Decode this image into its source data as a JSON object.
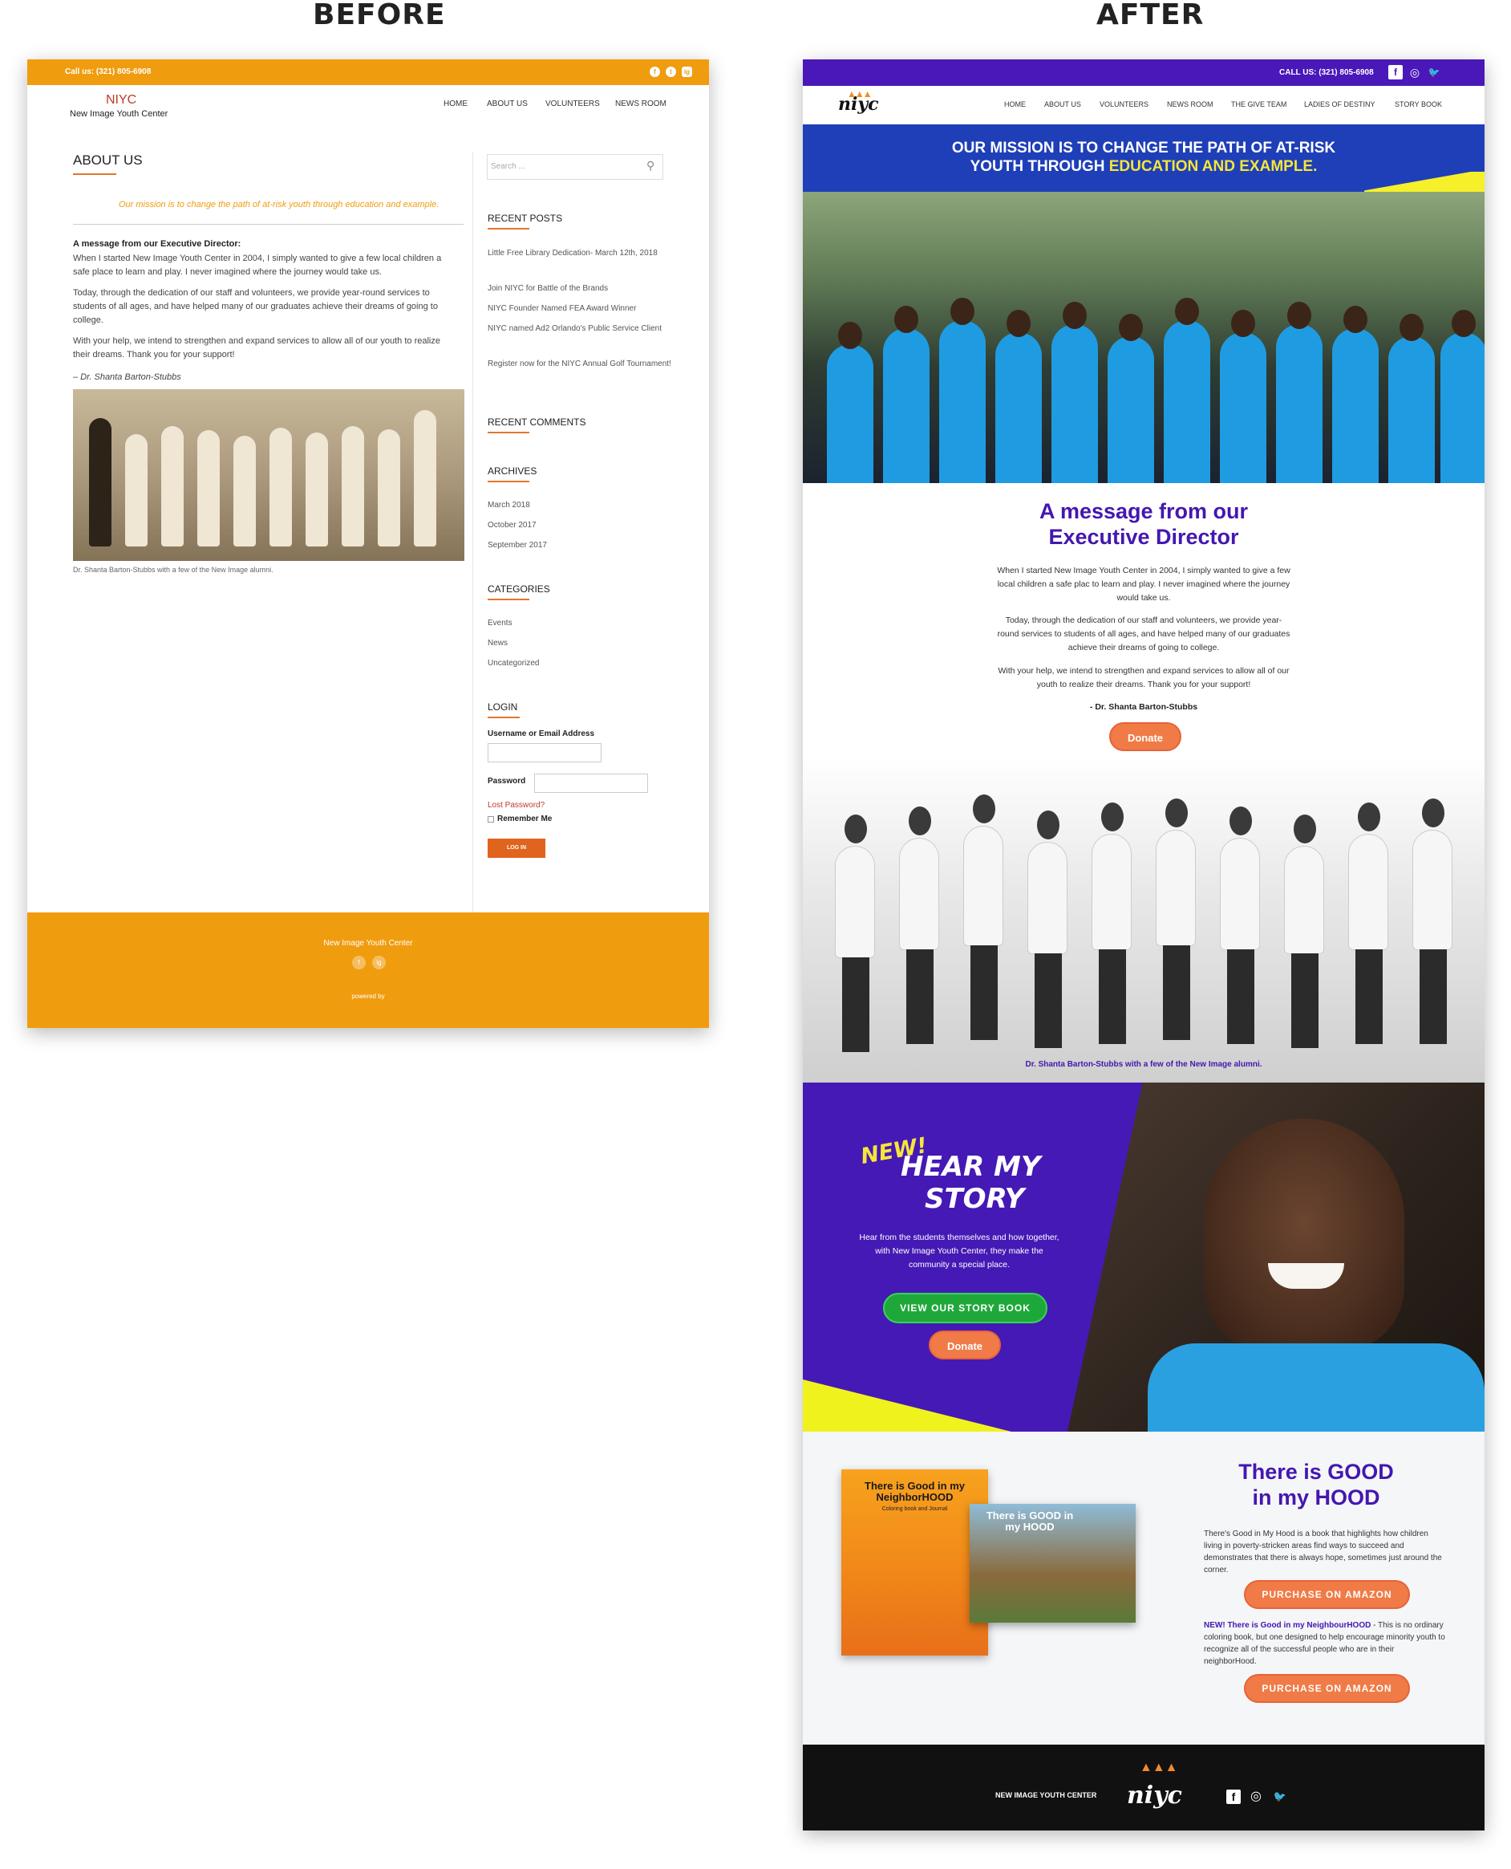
{
  "labels": {
    "before": "BEFORE",
    "after": "AFTER"
  },
  "before": {
    "topbar": {
      "call": "Call us: (321) 805-6908",
      "social": [
        "f",
        "t",
        "ig"
      ]
    },
    "logo": {
      "name": "NIYC",
      "subtitle": "New Image Youth Center"
    },
    "nav": [
      "HOME",
      "ABOUT US",
      "VOLUNTEERS",
      "NEWS ROOM"
    ],
    "page_title": "ABOUT US",
    "mission": "Our mission is to change the path of at-risk youth through education and example.",
    "message_heading": "A message from our Executive Director:",
    "paragraphs": [
      "When I started New Image Youth Center in 2004, I simply wanted to give a few local children a safe place to learn and play. I never imagined where the journey would take us.",
      "Today, through the dedication of our staff and volunteers, we provide year-round services to students of all ages, and have helped many of our graduates achieve their dreams of going to college.",
      "With your help, we intend to strengthen and expand services to allow all of our youth to realize their dreams. Thank you for your support!"
    ],
    "signature": "– Dr. Shanta Barton-Stubbs",
    "photo_caption": "Dr. Shanta Barton-Stubbs with a few of the New Image alumni.",
    "sidebar": {
      "search_placeholder": "Search ...",
      "recent_posts_title": "RECENT POSTS",
      "recent_posts": [
        "Little Free Library Dedication- March 12th, 2018",
        "Join NIYC for Battle of the Brands",
        "NIYC Founder Named FEA Award Winner",
        "NIYC named Ad2 Orlando's Public Service Client",
        "Register now for the NIYC Annual Golf Tournament!"
      ],
      "recent_comments_title": "RECENT COMMENTS",
      "archives_title": "ARCHIVES",
      "archives": [
        "March 2018",
        "October 2017",
        "September 2017"
      ],
      "categories_title": "CATEGORIES",
      "categories": [
        "Events",
        "News",
        "Uncategorized"
      ],
      "login_title": "LOGIN",
      "username_label": "Username or Email Address",
      "password_label": "Password",
      "lost_password": "Lost Password?",
      "remember_me": "Remember Me",
      "login_button": "LOG IN"
    },
    "footer": {
      "name": "New Image Youth Center",
      "social": [
        "f",
        "ig"
      ],
      "powered": "powered by"
    }
  },
  "after": {
    "topbar": {
      "call": "CALL US: (321) 805-6908",
      "social": [
        "f",
        "◎",
        "🐦"
      ]
    },
    "logo": "niyc",
    "nav": [
      "HOME",
      "ABOUT US",
      "VOLUNTEERS",
      "NEWS ROOM",
      "THE GIVE TEAM",
      "LADIES OF DESTINY",
      "STORY BOOK"
    ],
    "mission_line1": "OUR MISSION IS TO CHANGE THE PATH OF AT-RISK",
    "mission_line2_a": "YOUTH THROUGH ",
    "mission_line2_b": "EDUCATION AND EXAMPLE.",
    "message_heading_1": "A message from our",
    "message_heading_2": "Executive Director",
    "paragraphs": [
      "When I started New Image Youth Center in 2004, I simply wanted to give a few local children a safe plac to learn and play. I never imagined where the journey would take us.",
      "Today, through the dedication of our staff and volunteers, we provide year-round services to students of all ages, and have helped many of our graduates achieve their dreams of going to college.",
      "With your help, we intend to strengthen and expand services to allow all of our youth to realize their dreams. Thank you for your support!"
    ],
    "signature": "- Dr. Shanta Barton-Stubbs",
    "donate": "Donate",
    "group_caption": "Dr. Shanta Barton-Stubbs with a few of the New Image alumni.",
    "story": {
      "new": "NEW!",
      "hear": "HEAR MY",
      "story": "STORY",
      "text": "Hear from the students themselves and how together, with New Image Youth Center, they make the community a special place.",
      "button": "VIEW OUR STORY BOOK",
      "donate": "Donate"
    },
    "books": {
      "heading_1": "There is GOOD",
      "heading_2": "in my HOOD",
      "desc": "There's Good in My Hood is a book that highlights how children living in poverty-stricken areas find ways to succeed and demonstrates that there is always hope, sometimes just around the corner.",
      "new_label": "NEW! There is Good in my NeighbourHOOD",
      "new_desc": " - This is no ordinary coloring book, but one designed to help encourage minority youth to recognize all of the successful people who are in their neighborHood.",
      "button": "PURCHASE ON AMAZON",
      "book1_title": "There is Good in my NeighborHOOD",
      "book1_sub": "Coloring book and Journal",
      "book2_title": "There is GOOD in my HOOD"
    },
    "footer": {
      "name": "NEW IMAGE YOUTH CENTER",
      "logo": "niyc",
      "social": [
        "f",
        "◎",
        "🐦"
      ]
    }
  }
}
